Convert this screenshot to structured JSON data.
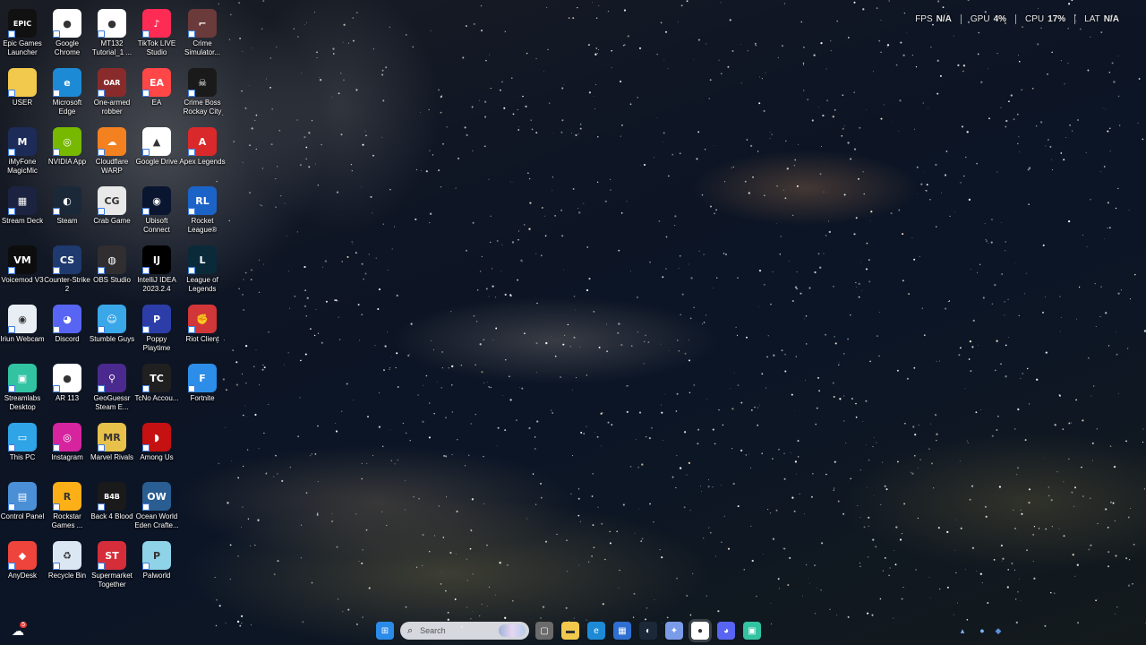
{
  "perf_overlay": [
    {
      "label": "FPS",
      "value": "N/A"
    },
    {
      "label": "GPU",
      "value": "4%"
    },
    {
      "label": "CPU",
      "value": "17%"
    },
    {
      "label": "LAT",
      "value": "N/A"
    }
  ],
  "icons": {
    "c0": [
      {
        "label": "Epic Games Launcher",
        "icon": "epic-games-icon",
        "glyph": "EPIC",
        "bg": "#111111"
      },
      {
        "label": "USER",
        "icon": "folder-icon",
        "glyph": "",
        "bg": "#f2c94c"
      },
      {
        "label": "iMyFone MagicMic",
        "icon": "magicmic-icon",
        "glyph": "M",
        "bg": "#1c2b57"
      },
      {
        "label": "Stream Deck",
        "icon": "stream-deck-icon",
        "glyph": "▦",
        "bg": "#1b2340"
      },
      {
        "label": "Voicemod V3",
        "icon": "voicemod-icon",
        "glyph": "VM",
        "bg": "#0d0d0d"
      },
      {
        "label": "Iriun Webcam",
        "icon": "webcam-icon",
        "glyph": "◉",
        "bg": "#e9eef4"
      },
      {
        "label": "Streamlabs Desktop",
        "icon": "streamlabs-icon",
        "glyph": "▣",
        "bg": "#31c3a2"
      },
      {
        "label": "This PC",
        "icon": "this-pc-icon",
        "glyph": "▭",
        "bg": "#2fa4e7"
      },
      {
        "label": "Control Panel",
        "icon": "control-panel-icon",
        "glyph": "▤",
        "bg": "#4b8fd6"
      },
      {
        "label": "AnyDesk",
        "icon": "anydesk-icon",
        "glyph": "◆",
        "bg": "#ef443b"
      }
    ],
    "c1": [
      {
        "label": "Google Chrome",
        "icon": "chrome-icon",
        "glyph": "●",
        "bg": "#ffffff"
      },
      {
        "label": "Microsoft Edge",
        "icon": "edge-icon",
        "glyph": "e",
        "bg": "#1d8ad6"
      },
      {
        "label": "NVIDIA App",
        "icon": "nvidia-icon",
        "glyph": "◎",
        "bg": "#76b900"
      },
      {
        "label": "Steam",
        "icon": "steam-icon",
        "glyph": "◐",
        "bg": "#1b2838"
      },
      {
        "label": "Counter-Strike 2",
        "icon": "cs2-icon",
        "glyph": "CS",
        "bg": "#1e3a6e"
      },
      {
        "label": "Discord",
        "icon": "discord-icon",
        "glyph": "◕",
        "bg": "#5865f2"
      },
      {
        "label": "AR 113",
        "icon": "chrome-doc-icon",
        "glyph": "●",
        "bg": "#ffffff"
      },
      {
        "label": "Instagram",
        "icon": "instagram-icon",
        "glyph": "◎",
        "bg": "#d6249f"
      },
      {
        "label": "Rockstar Games ...",
        "icon": "rockstar-icon",
        "glyph": "R",
        "bg": "#fcaf17"
      },
      {
        "label": "Recycle Bin",
        "icon": "recycle-bin-icon",
        "glyph": "♻",
        "bg": "#dbe7f3"
      }
    ],
    "c2": [
      {
        "label": "MT132 Tutorial_1 ...",
        "icon": "chrome-doc-icon",
        "glyph": "●",
        "bg": "#ffffff"
      },
      {
        "label": "One-armed robber",
        "icon": "one-armed-robber-icon",
        "glyph": "OAR",
        "bg": "#8a2b2b"
      },
      {
        "label": "Cloudflare WARP",
        "icon": "cloudflare-icon",
        "glyph": "☁",
        "bg": "#f48120"
      },
      {
        "label": "Crab Game",
        "icon": "crab-game-icon",
        "glyph": "CG",
        "bg": "#e9e9e9"
      },
      {
        "label": "OBS Studio",
        "icon": "obs-icon",
        "glyph": "◍",
        "bg": "#302e31"
      },
      {
        "label": "Stumble Guys",
        "icon": "stumble-guys-icon",
        "glyph": "☺",
        "bg": "#39a7e8"
      },
      {
        "label": "GeoGuessr Steam E...",
        "icon": "geoguessr-icon",
        "glyph": "⚲",
        "bg": "#4b2a8f"
      },
      {
        "label": "Marvel Rivals",
        "icon": "marvel-rivals-icon",
        "glyph": "MR",
        "bg": "#e8c14a"
      },
      {
        "label": "Back 4 Blood",
        "icon": "back4blood-icon",
        "glyph": "B4B",
        "bg": "#1a1a1a"
      },
      {
        "label": "Supermarket Together",
        "icon": "supermarket-icon",
        "glyph": "ST",
        "bg": "#d62d3a"
      }
    ],
    "c3": [
      {
        "label": "TikTok LIVE Studio",
        "icon": "tiktok-icon",
        "glyph": "♪",
        "bg": "#fe2c55"
      },
      {
        "label": "EA",
        "icon": "ea-icon",
        "glyph": "EA",
        "bg": "#ff4747"
      },
      {
        "label": "Google Drive",
        "icon": "google-drive-icon",
        "glyph": "▲",
        "bg": "#ffffff"
      },
      {
        "label": "Ubisoft Connect",
        "icon": "ubisoft-icon",
        "glyph": "◉",
        "bg": "#0a1530"
      },
      {
        "label": "IntelliJ IDEA 2023.2.4",
        "icon": "intellij-icon",
        "glyph": "IJ",
        "bg": "#000000"
      },
      {
        "label": "Poppy Playtime",
        "icon": "poppy-playtime-icon",
        "glyph": "P",
        "bg": "#2d3da8"
      },
      {
        "label": "TcNo Accou...",
        "icon": "tcno-icon",
        "glyph": "TC",
        "bg": "#202020"
      },
      {
        "label": "Among Us",
        "icon": "among-us-icon",
        "glyph": "◗",
        "bg": "#c51111"
      },
      {
        "label": "Ocean World Eden Crafte...",
        "icon": "ocean-world-icon",
        "glyph": "OW",
        "bg": "#2a5d91"
      },
      {
        "label": "Palworld",
        "icon": "palworld-icon",
        "glyph": "P",
        "bg": "#8fd3e8"
      }
    ],
    "c4": [
      {
        "label": "Crime Simulator...",
        "icon": "crime-simulator-icon",
        "glyph": "⌐",
        "bg": "#6b3a3a"
      },
      {
        "label": "Crime Boss Rockay City",
        "icon": "crime-boss-icon",
        "glyph": "☠",
        "bg": "#1a1a1a"
      },
      {
        "label": "Apex Legends",
        "icon": "apex-icon",
        "glyph": "A",
        "bg": "#da292a"
      },
      {
        "label": "Rocket League®",
        "icon": "rocket-league-icon",
        "glyph": "RL",
        "bg": "#1c63c8"
      },
      {
        "label": "League of Legends",
        "icon": "league-icon",
        "glyph": "L",
        "bg": "#0a2a3a"
      },
      {
        "label": "Riot Client",
        "icon": "riot-icon",
        "glyph": "✊",
        "bg": "#d13639"
      },
      {
        "label": "Fortnite",
        "icon": "fortnite-icon",
        "glyph": "F",
        "bg": "#2c8ee8"
      }
    ]
  },
  "taskbar": {
    "search_placeholder": "Search",
    "notification_badge": "5",
    "apps": [
      {
        "name": "windows-start-icon",
        "glyph": "⊞",
        "bg": "#2b8be8"
      },
      {
        "name": "task-view-icon",
        "glyph": "▢",
        "bg": "#6b6b6b"
      },
      {
        "name": "file-explorer-icon",
        "glyph": "▬",
        "bg": "#f2c94c"
      },
      {
        "name": "edge-icon",
        "glyph": "e",
        "bg": "#1d8ad6"
      },
      {
        "name": "microsoft-store-icon",
        "glyph": "▦",
        "bg": "#2e6fd1"
      },
      {
        "name": "steam-icon",
        "glyph": "◐",
        "bg": "#1b2838"
      },
      {
        "name": "copilot-icon",
        "glyph": "✦",
        "bg": "#7a9be8"
      },
      {
        "name": "chrome-icon",
        "glyph": "●",
        "bg": "#ffffff"
      },
      {
        "name": "discord-icon",
        "glyph": "◕",
        "bg": "#5865f2"
      },
      {
        "name": "streamlabs-icon",
        "glyph": "▣",
        "bg": "#31c3a2"
      }
    ]
  }
}
